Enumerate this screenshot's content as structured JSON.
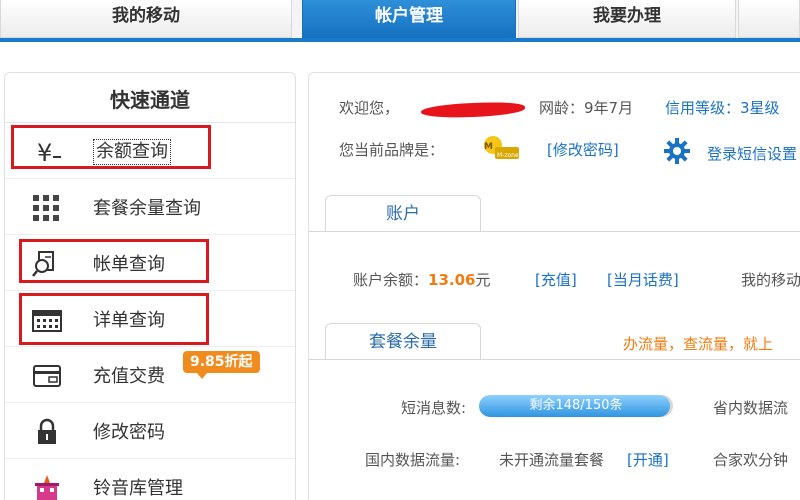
{
  "top_nav": {
    "tabs": [
      {
        "label": "我的移动",
        "active": false
      },
      {
        "label": "帐户管理",
        "active": true
      },
      {
        "label": "我要办理",
        "active": false
      }
    ]
  },
  "sidebar": {
    "title": "快速通道",
    "items": [
      {
        "label": "余额查询",
        "icon": "yen-icon",
        "highlighted": true
      },
      {
        "label": "套餐余量查询",
        "icon": "grid-icon",
        "highlighted": false
      },
      {
        "label": "帐单查询",
        "icon": "bill-search-icon",
        "highlighted": true
      },
      {
        "label": "详单查询",
        "icon": "calendar-icon",
        "highlighted": true
      },
      {
        "label": "充值交费",
        "icon": "wallet-icon",
        "highlighted": false,
        "badge": "9.85折起"
      },
      {
        "label": "修改密码",
        "icon": "lock-icon",
        "highlighted": false
      },
      {
        "label": "铃音库管理",
        "icon": "ringtone-icon",
        "highlighted": false
      }
    ]
  },
  "account": {
    "welcome": "欢迎您，",
    "network_age": "网龄：9年7月",
    "credit_level": "信用等级：3星级",
    "brand_label": "您当前品牌是：",
    "brand_logo_text": "M-zone",
    "change_password": "[修改密码]",
    "sms_login": "登录短信设置",
    "tab_account": "账户",
    "balance_label": "账户余额：",
    "balance_value": "13.06",
    "balance_unit": "元",
    "recharge_link": "[充值]",
    "monthly_fee_link": "[当月话费]",
    "my_points_partial": "我的移动"
  },
  "package": {
    "tab_label": "套餐余量",
    "promo_text": "办流量，查流量，就上",
    "sms_label": "短消息数:",
    "sms_progress_text": "剩余148/150条",
    "sms_remaining": 148,
    "sms_total": 150,
    "domestic_data_partial": "省内数据流",
    "national_data_label": "国内数据流量:",
    "national_data_status": "未开通流量套餐",
    "open_link": "[开通]",
    "family_share_partial": "合家欢分钟"
  },
  "colors": {
    "accent": "#1a7acc",
    "highlight_red": "#d8191e",
    "orange": "#f07c10",
    "link_blue": "#1a72c4"
  }
}
